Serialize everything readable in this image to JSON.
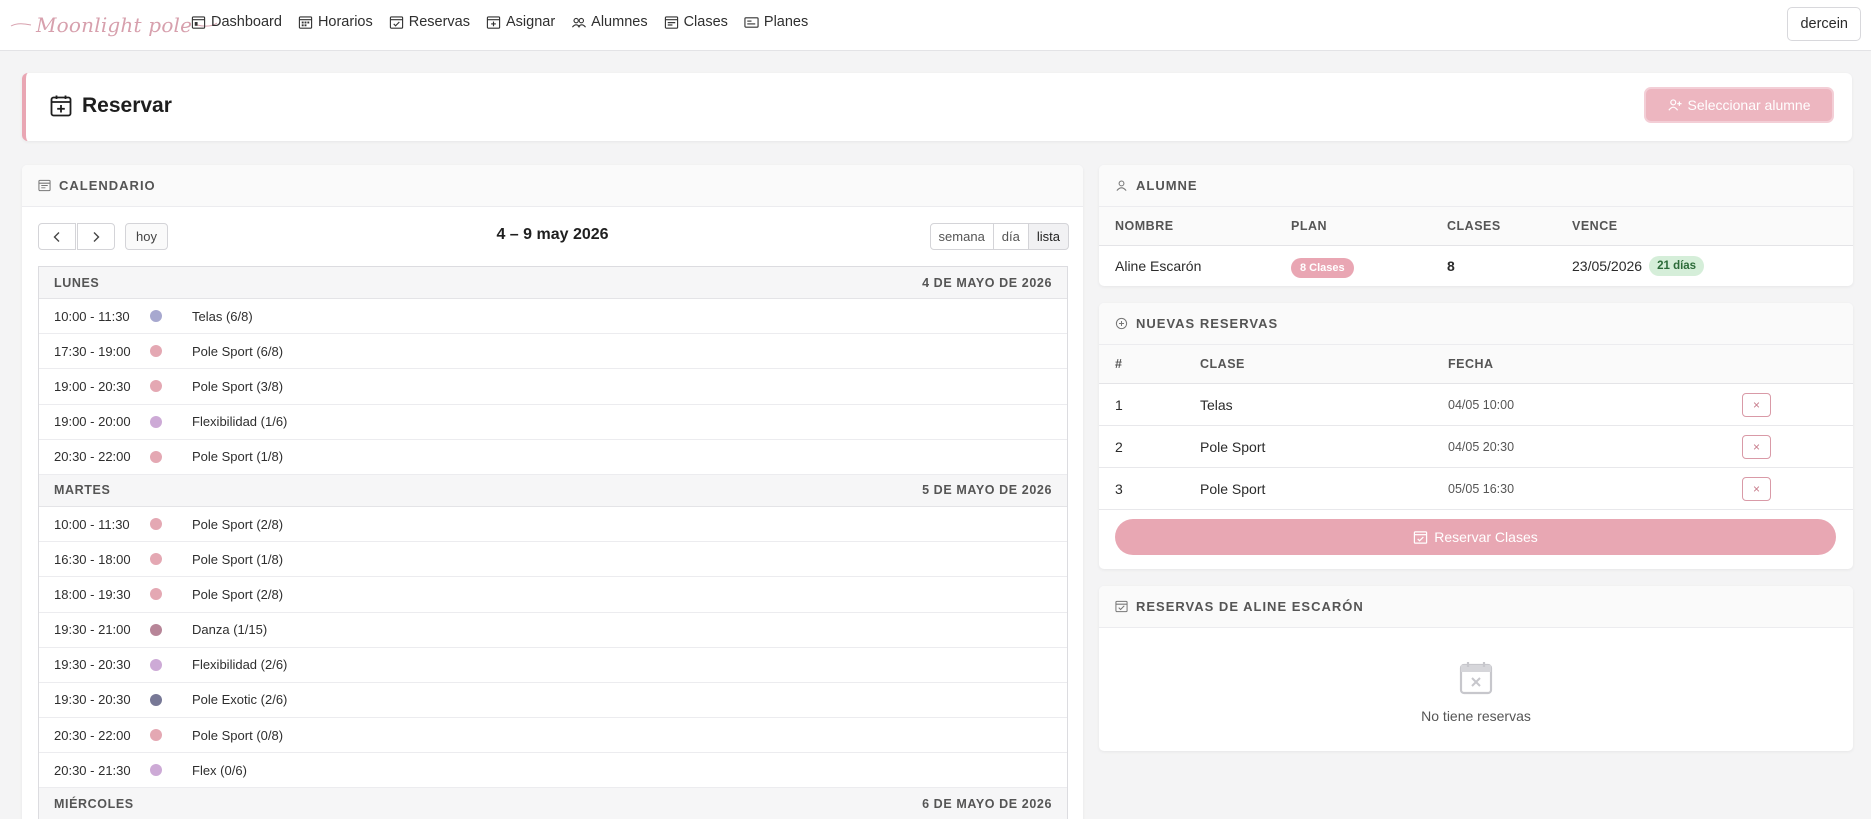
{
  "brand": {
    "logo_text": "Moonlight pole"
  },
  "nav": {
    "items": [
      {
        "label": "Dashboard",
        "icon": "dashboard-icon"
      },
      {
        "label": "Horarios",
        "icon": "schedule-icon"
      },
      {
        "label": "Reservas",
        "icon": "reservations-icon"
      },
      {
        "label": "Asignar",
        "icon": "assign-icon"
      },
      {
        "label": "Alumnes",
        "icon": "students-icon"
      },
      {
        "label": "Clases",
        "icon": "classes-icon"
      },
      {
        "label": "Planes",
        "icon": "plans-icon"
      }
    ],
    "user": "dercein"
  },
  "header": {
    "title": "Reservar",
    "select_button": "Seleccionar alumne"
  },
  "calendar": {
    "heading": "CALENDARIO",
    "today_label": "hoy",
    "range": "4 – 9 may 2026",
    "views": [
      "semana",
      "día",
      "lista"
    ],
    "active_view": "lista",
    "days": [
      {
        "name": "LUNES",
        "date": "4 DE MAYO DE 2026",
        "events": [
          {
            "time": "10:00 - 11:30",
            "title": "Telas (6/8)",
            "color": "#a7a8cf"
          },
          {
            "time": "17:30 - 19:00",
            "title": "Pole Sport (6/8)",
            "color": "#e4a8b3"
          },
          {
            "time": "19:00 - 20:30",
            "title": "Pole Sport (3/8)",
            "color": "#e4a8b3"
          },
          {
            "time": "19:00 - 20:00",
            "title": "Flexibilidad (1/6)",
            "color": "#cdaad6"
          },
          {
            "time": "20:30 - 22:00",
            "title": "Pole Sport (1/8)",
            "color": "#e4a8b3"
          }
        ]
      },
      {
        "name": "MARTES",
        "date": "5 DE MAYO DE 2026",
        "events": [
          {
            "time": "10:00 - 11:30",
            "title": "Pole Sport (2/8)",
            "color": "#e4a8b3"
          },
          {
            "time": "16:30 - 18:00",
            "title": "Pole Sport (1/8)",
            "color": "#e4a8b3"
          },
          {
            "time": "18:00 - 19:30",
            "title": "Pole Sport (2/8)",
            "color": "#e4a8b3"
          },
          {
            "time": "19:30 - 21:00",
            "title": "Danza (1/15)",
            "color": "#b78598"
          },
          {
            "time": "19:30 - 20:30",
            "title": "Flexibilidad (2/6)",
            "color": "#cdaad6"
          },
          {
            "time": "19:30 - 20:30",
            "title": "Pole Exotic (2/6)",
            "color": "#777896"
          },
          {
            "time": "20:30 - 22:00",
            "title": "Pole Sport (0/8)",
            "color": "#e4a8b3"
          },
          {
            "time": "20:30 - 21:30",
            "title": "Flex (0/6)",
            "color": "#cdaad6"
          }
        ]
      },
      {
        "name": "MIÉRCOLES",
        "date": "6 DE MAYO DE 2026",
        "events": []
      }
    ]
  },
  "alumne": {
    "heading": "ALUMNE",
    "columns": [
      "NOMBRE",
      "PLAN",
      "CLASES",
      "VENCE"
    ],
    "row": {
      "nombre": "Aline Escarón",
      "plan": "8 Clases",
      "clases": "8",
      "vence": "23/05/2026",
      "days_left": "21 días"
    }
  },
  "nuevas": {
    "heading": "NUEVAS RESERVAS",
    "columns": [
      "#",
      "CLASE",
      "FECHA"
    ],
    "rows": [
      {
        "n": "1",
        "clase": "Telas",
        "fecha": "04/05 10:00",
        "remove": "×"
      },
      {
        "n": "2",
        "clase": "Pole Sport",
        "fecha": "04/05 20:30",
        "remove": "×"
      },
      {
        "n": "3",
        "clase": "Pole Sport",
        "fecha": "05/05 16:30",
        "remove": "×"
      }
    ],
    "submit_label": "Reservar Clases"
  },
  "reservas": {
    "heading": "RESERVAS DE ALINE ESCARÓN",
    "empty_text": "No tiene reservas"
  },
  "colors": {
    "accent": "#e9a6b3",
    "success_bg": "#d5eed9"
  }
}
